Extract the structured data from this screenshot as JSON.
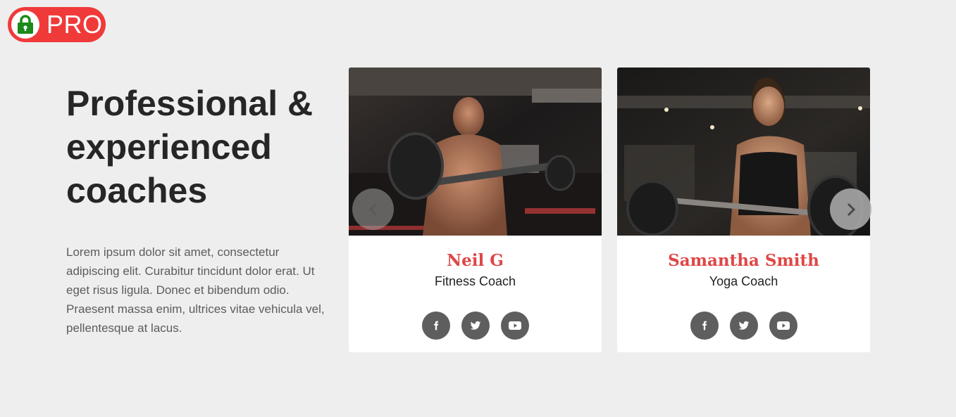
{
  "badge": {
    "label": "PRO",
    "icon": "lock-icon",
    "color": "#f03a3a"
  },
  "section": {
    "headline": "Professional & experienced coaches",
    "description": "Lorem ipsum dolor sit amet, consectetur adipiscing elit. Curabitur tincidunt dolor erat. Ut eget risus ligula. Donec et bibendum odio. Praesent massa enim, ultrices vitae vehicula vel, pellentesque at lacus."
  },
  "coaches": [
    {
      "name": "Neil G",
      "role": "Fitness Coach",
      "socials": [
        "facebook-icon",
        "twitter-icon",
        "youtube-icon"
      ]
    },
    {
      "name": "Samantha Smith",
      "role": "Yoga Coach",
      "socials": [
        "facebook-icon",
        "twitter-icon",
        "youtube-icon"
      ]
    }
  ],
  "carousel": {
    "prev_icon": "chevron-left-icon",
    "next_icon": "chevron-right-icon"
  },
  "colors": {
    "accent": "#df4747",
    "background": "#eeeeee",
    "social_button": "#5e5e5e"
  }
}
